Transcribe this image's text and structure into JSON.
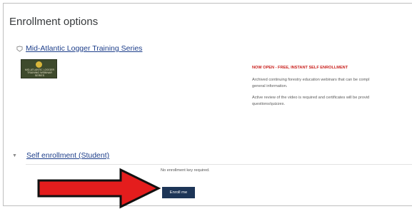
{
  "page": {
    "title": "Enrollment options"
  },
  "course": {
    "name": "Mid-Atlantic Logger Training Series",
    "image_text": "MID-ATLANTIC LOGGER TRAINING WEBINAR SERIES",
    "image_icon": "gear-logo",
    "summary": {
      "headline": "NOW OPEN - FREE, INSTANT SELF ENROLLMENT",
      "paragraph_1_line_1": "Archived continuing forestry education webinars that can be compl",
      "paragraph_1_line_2": "general information.",
      "paragraph_2_line_1": "Active review of the video is required and certificates will be provid",
      "paragraph_2_line_2": "questions/quizzes."
    }
  },
  "enrolment": {
    "method_name": "Self enrollment (Student)",
    "collapse_icon": "chevron-down-icon",
    "key_note": "No enrollment key required.",
    "enroll_button_label": "Enroll me"
  },
  "annotation": {
    "arrow_icon": "red-arrow-pointer",
    "arrow_color": "#e41d1d"
  },
  "colors": {
    "link": "#1d3e8a",
    "headline": "#c9211e",
    "button_bg": "#1d3557"
  }
}
